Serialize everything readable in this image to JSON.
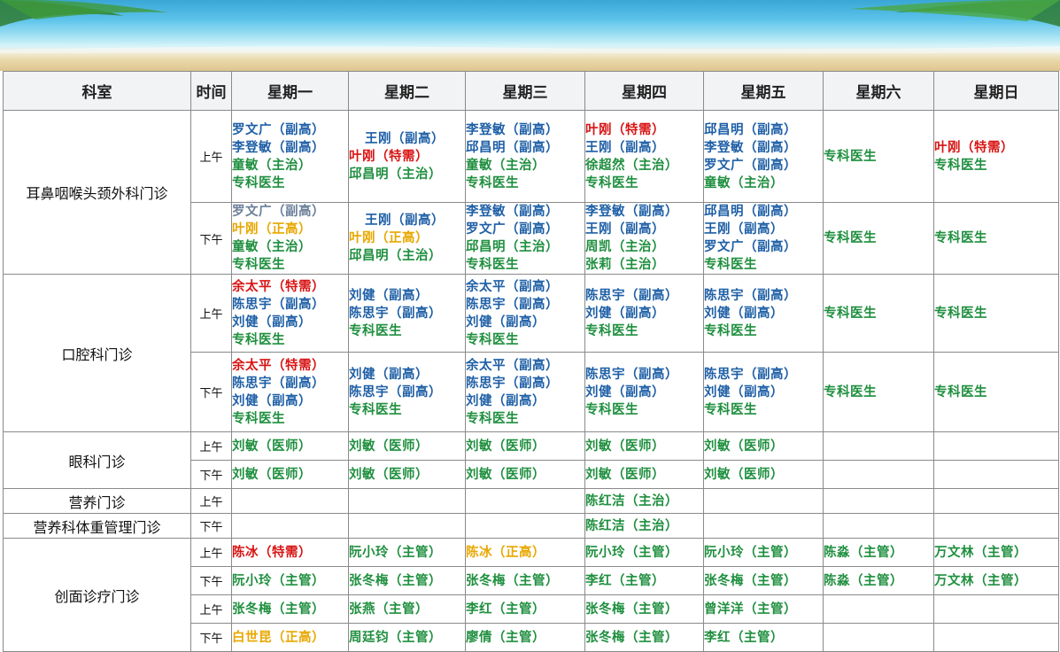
{
  "colors": {
    "blue": "#1e5fa6",
    "green": "#1f8f3f",
    "red": "#d81414",
    "yellow": "#e8a800",
    "gray": "#6b7f9a"
  },
  "headers": [
    "科室",
    "时间",
    "星期一",
    "星期二",
    "星期三",
    "星期四",
    "星期五",
    "星期六",
    "星期日"
  ],
  "departments": [
    {
      "name": "耳鼻咽喉头颈外科门诊",
      "sessions": [
        {
          "period": "上午",
          "days": [
            [
              {
                "t": "罗文广（副高）",
                "c": "blue"
              },
              {
                "t": "李登敏（副高）",
                "c": "blue"
              },
              {
                "t": "童敏（主治）",
                "c": "green"
              },
              {
                "t": "专科医生",
                "c": "green"
              }
            ],
            [
              {
                "t": "王刚（副高）",
                "c": "blue",
                "i": 1
              },
              {
                "t": "叶刚（特需）",
                "c": "red"
              },
              {
                "t": "邱昌明（主治）",
                "c": "green"
              }
            ],
            [
              {
                "t": "李登敏（副高）",
                "c": "blue"
              },
              {
                "t": "邱昌明（副高）",
                "c": "blue"
              },
              {
                "t": "童敏（主治）",
                "c": "green"
              },
              {
                "t": "专科医生",
                "c": "green"
              }
            ],
            [
              {
                "t": "叶刚（特需）",
                "c": "red"
              },
              {
                "t": "王刚（副高）",
                "c": "blue"
              },
              {
                "t": "徐超然（主治）",
                "c": "green"
              },
              {
                "t": "专科医生",
                "c": "green"
              }
            ],
            [
              {
                "t": "邱昌明（副高）",
                "c": "blue"
              },
              {
                "t": "李登敏（副高）",
                "c": "blue"
              },
              {
                "t": "罗文广（副高）",
                "c": "blue"
              },
              {
                "t": "童敏（主治）",
                "c": "green"
              }
            ],
            [
              {
                "t": "专科医生",
                "c": "green"
              }
            ],
            [
              {
                "t": "叶刚（特需）",
                "c": "red"
              },
              {
                "t": "专科医生",
                "c": "green"
              }
            ]
          ]
        },
        {
          "period": "下午",
          "days": [
            [
              {
                "t": "罗文广（副高）",
                "c": "gray"
              },
              {
                "t": "叶刚（正高）",
                "c": "yellow"
              },
              {
                "t": "童敏（主治）",
                "c": "green"
              },
              {
                "t": "专科医生",
                "c": "green"
              }
            ],
            [
              {
                "t": "王刚（副高）",
                "c": "blue",
                "i": 1
              },
              {
                "t": "叶刚（正高）",
                "c": "yellow"
              },
              {
                "t": "邱昌明（主治）",
                "c": "green"
              }
            ],
            [
              {
                "t": "李登敏（副高）",
                "c": "blue"
              },
              {
                "t": "罗文广（副高）",
                "c": "blue"
              },
              {
                "t": "邱昌明（主治）",
                "c": "green"
              },
              {
                "t": "专科医生",
                "c": "green"
              }
            ],
            [
              {
                "t": "李登敏（副高）",
                "c": "blue"
              },
              {
                "t": "王刚（副高）",
                "c": "blue"
              },
              {
                "t": "周凯（主治）",
                "c": "green"
              },
              {
                "t": "张莉（主治）",
                "c": "green"
              }
            ],
            [
              {
                "t": "邱昌明（副高）",
                "c": "blue"
              },
              {
                "t": "王刚（副高）",
                "c": "blue"
              },
              {
                "t": "罗文广（副高）",
                "c": "blue"
              },
              {
                "t": "专科医生",
                "c": "green"
              }
            ],
            [
              {
                "t": "专科医生",
                "c": "green"
              }
            ],
            [
              {
                "t": "专科医生",
                "c": "green"
              }
            ]
          ]
        }
      ]
    },
    {
      "name": "口腔科门诊",
      "sessions": [
        {
          "period": "上午",
          "days": [
            [
              {
                "t": "余太平（特需）",
                "c": "red"
              },
              {
                "t": "陈思宇（副高）",
                "c": "blue"
              },
              {
                "t": "刘健（副高）",
                "c": "blue"
              },
              {
                "t": "专科医生",
                "c": "green"
              }
            ],
            [
              {
                "t": "刘健（副高）",
                "c": "blue"
              },
              {
                "t": "陈思宇（副高）",
                "c": "blue"
              },
              {
                "t": "专科医生",
                "c": "green"
              }
            ],
            [
              {
                "t": "余太平（副高）",
                "c": "blue"
              },
              {
                "t": "陈思宇（副高）",
                "c": "blue"
              },
              {
                "t": "刘健（副高）",
                "c": "blue"
              },
              {
                "t": "专科医生",
                "c": "green"
              }
            ],
            [
              {
                "t": "陈思宇（副高）",
                "c": "blue"
              },
              {
                "t": "刘健（副高）",
                "c": "blue"
              },
              {
                "t": "专科医生",
                "c": "green"
              }
            ],
            [
              {
                "t": "陈思宇（副高）",
                "c": "blue"
              },
              {
                "t": "刘健（副高）",
                "c": "blue"
              },
              {
                "t": "专科医生",
                "c": "green"
              }
            ],
            [
              {
                "t": "专科医生",
                "c": "green"
              }
            ],
            [
              {
                "t": "专科医生",
                "c": "green"
              }
            ]
          ]
        },
        {
          "period": "下午",
          "days": [
            [
              {
                "t": "余太平（特需）",
                "c": "red"
              },
              {
                "t": "陈思宇（副高）",
                "c": "blue"
              },
              {
                "t": "刘健（副高）",
                "c": "blue"
              },
              {
                "t": "专科医生",
                "c": "green"
              }
            ],
            [
              {
                "t": "刘健（副高）",
                "c": "blue"
              },
              {
                "t": "陈思宇（副高）",
                "c": "blue"
              },
              {
                "t": "专科医生",
                "c": "green"
              }
            ],
            [
              {
                "t": "余太平（副高）",
                "c": "blue"
              },
              {
                "t": "陈思宇（副高）",
                "c": "blue"
              },
              {
                "t": "刘健（副高）",
                "c": "blue"
              },
              {
                "t": "专科医生",
                "c": "green"
              }
            ],
            [
              {
                "t": "陈思宇（副高）",
                "c": "blue"
              },
              {
                "t": "刘健（副高）",
                "c": "blue"
              },
              {
                "t": "专科医生",
                "c": "green"
              }
            ],
            [
              {
                "t": "陈思宇（副高）",
                "c": "blue"
              },
              {
                "t": "刘健（副高）",
                "c": "blue"
              },
              {
                "t": "专科医生",
                "c": "green"
              }
            ],
            [
              {
                "t": "专科医生",
                "c": "green"
              }
            ],
            [
              {
                "t": "专科医生",
                "c": "green"
              }
            ]
          ]
        }
      ]
    },
    {
      "name": "眼科门诊",
      "sessions": [
        {
          "period": "上午",
          "days": [
            [
              {
                "t": "刘敏（医师）",
                "c": "green"
              }
            ],
            [
              {
                "t": "刘敏（医师）",
                "c": "green"
              }
            ],
            [
              {
                "t": "刘敏（医师）",
                "c": "green"
              }
            ],
            [
              {
                "t": "刘敏（医师）",
                "c": "green"
              }
            ],
            [
              {
                "t": "刘敏（医师）",
                "c": "green"
              }
            ],
            [],
            []
          ]
        },
        {
          "period": "下午",
          "days": [
            [
              {
                "t": "刘敏（医师）",
                "c": "green"
              }
            ],
            [
              {
                "t": "刘敏（医师）",
                "c": "green"
              }
            ],
            [
              {
                "t": "刘敏（医师）",
                "c": "green"
              }
            ],
            [
              {
                "t": "刘敏（医师）",
                "c": "green"
              }
            ],
            [
              {
                "t": "刘敏（医师）",
                "c": "green"
              }
            ],
            [],
            []
          ]
        }
      ]
    },
    {
      "name": "营养门诊",
      "sessions": [
        {
          "period": "上午",
          "days": [
            [],
            [],
            [],
            [
              {
                "t": "陈红洁（主治）",
                "c": "green"
              }
            ],
            [],
            [],
            []
          ]
        }
      ]
    },
    {
      "name": "营养科体重管理门诊",
      "sessions": [
        {
          "period": "下午",
          "days": [
            [],
            [],
            [],
            [
              {
                "t": "陈红洁（主治）",
                "c": "green"
              }
            ],
            [],
            [],
            []
          ]
        }
      ]
    },
    {
      "name": "创面诊疗门诊",
      "sessions": [
        {
          "period": "上午",
          "days": [
            [
              {
                "t": "陈冰（特需）",
                "c": "red"
              }
            ],
            [
              {
                "t": "阮小玲（主管）",
                "c": "green"
              }
            ],
            [
              {
                "t": "陈冰（正高）",
                "c": "yellow"
              }
            ],
            [
              {
                "t": "阮小玲（主管）",
                "c": "green"
              }
            ],
            [
              {
                "t": "阮小玲（主管）",
                "c": "green"
              }
            ],
            [
              {
                "t": "陈淼（主管）",
                "c": "green"
              }
            ],
            [
              {
                "t": "万文林（主管）",
                "c": "green"
              }
            ]
          ]
        },
        {
          "period": "下午",
          "days": [
            [
              {
                "t": "阮小玲（主管）",
                "c": "green"
              }
            ],
            [
              {
                "t": "张冬梅（主管）",
                "c": "green"
              }
            ],
            [
              {
                "t": "张冬梅（主管）",
                "c": "green"
              }
            ],
            [
              {
                "t": "李红（主管）",
                "c": "green"
              }
            ],
            [
              {
                "t": "张冬梅（主管）",
                "c": "green"
              }
            ],
            [
              {
                "t": "陈淼（主管）",
                "c": "green"
              }
            ],
            [
              {
                "t": "万文林（主管）",
                "c": "green"
              }
            ]
          ]
        },
        {
          "period": "上午",
          "days": [
            [
              {
                "t": "张冬梅（主管）",
                "c": "green"
              }
            ],
            [
              {
                "t": "张燕（主管）",
                "c": "green"
              }
            ],
            [
              {
                "t": "李红（主管）",
                "c": "green"
              }
            ],
            [
              {
                "t": "张冬梅（主管）",
                "c": "green"
              }
            ],
            [
              {
                "t": "曾洋洋（主管）",
                "c": "green"
              }
            ],
            [],
            []
          ]
        },
        {
          "period": "下午",
          "days": [
            [
              {
                "t": "白世昆（正高）",
                "c": "yellow"
              }
            ],
            [
              {
                "t": "周廷钧（主管）",
                "c": "green"
              }
            ],
            [
              {
                "t": "廖倩（主管）",
                "c": "green"
              }
            ],
            [
              {
                "t": "张冬梅（主管）",
                "c": "green"
              }
            ],
            [
              {
                "t": "李红（主管）",
                "c": "green"
              }
            ],
            [],
            []
          ]
        }
      ]
    }
  ]
}
